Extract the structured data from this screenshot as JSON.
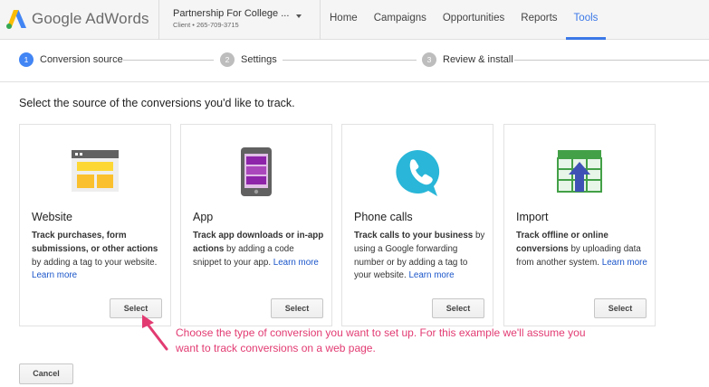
{
  "header": {
    "brand": "Google AdWords",
    "account_name": "Partnership For College ...",
    "account_sub": "Client • 265-709-3715",
    "nav": [
      {
        "label": "Home"
      },
      {
        "label": "Campaigns"
      },
      {
        "label": "Opportunities"
      },
      {
        "label": "Reports"
      },
      {
        "label": "Tools"
      }
    ],
    "active_nav": "Tools",
    "accent_color": "#3b78e7"
  },
  "steps": [
    {
      "num": "1",
      "label": "Conversion source",
      "active": true
    },
    {
      "num": "2",
      "label": "Settings",
      "active": false
    },
    {
      "num": "3",
      "label": "Review & install",
      "active": false
    }
  ],
  "prompt": "Select the source of the conversions you'd like to track.",
  "cards": [
    {
      "title": "Website",
      "desc_bold": "Track purchases, form submissions, or other actions",
      "desc_rest": " by adding a tag to your website. ",
      "learn_more": "Learn more",
      "button": "Select",
      "icon": "website-icon"
    },
    {
      "title": "App",
      "desc_bold": "Track app downloads or in-app actions",
      "desc_rest": " by adding a code snippet to your app. ",
      "learn_more": "Learn more",
      "button": "Select",
      "icon": "phone-app-icon"
    },
    {
      "title": "Phone calls",
      "desc_bold": "Track calls to your business",
      "desc_rest": " by using a Google forwarding number or by adding a tag to your website. ",
      "learn_more": "Learn more",
      "button": "Select",
      "icon": "phone-call-icon"
    },
    {
      "title": "Import",
      "desc_bold": "Track offline or online conversions",
      "desc_rest": " by uploading data from another system. ",
      "learn_more": "Learn more",
      "button": "Select",
      "icon": "import-icon"
    }
  ],
  "annotation": "Choose the type of conversion you want to set up.  For this example we'll assume you want to track conversions on a web page.",
  "annotation_color": "#e23b72",
  "cancel": "Cancel"
}
